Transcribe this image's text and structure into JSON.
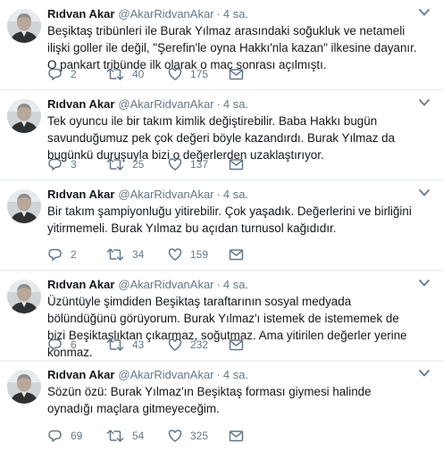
{
  "feed": {
    "tweets": [
      {
        "name": "Rıdvan Akar",
        "handle": "@AkarRidvanAkar",
        "dot": "·",
        "time": "4 sa.",
        "text": "Beşiktaş tribünleri ile Burak Yılmaz arasındaki soğukluk ve netameli ilişki goller ile değil, \"Şerefin'le oyna Hakkı'nla kazan\" ilkesine dayanır. O pankart tribünde ilk olarak o maç sonrası açılmıştı.",
        "replies": "2",
        "retweets": "40",
        "likes": "175"
      },
      {
        "name": "Rıdvan Akar",
        "handle": "@AkarRidvanAkar",
        "dot": "·",
        "time": "4 sa.",
        "text": "Tek oyuncu ile bir takım kimlik değiştirebilir. Baba Hakkı bugün savunduğumuz pek çok değeri böyle kazandırdı. Burak Yılmaz da bugünkü duruşuyla bizi o değerlerden uzaklaştırıyor.",
        "replies": "3",
        "retweets": "25",
        "likes": "137"
      },
      {
        "name": "Rıdvan Akar",
        "handle": "@AkarRidvanAkar",
        "dot": "·",
        "time": "4 sa.",
        "text": "Bir takım şampiyonluğu yitirebilir. Çok yaşadık. Değerlerini ve birliğini yitirmemeli. Burak Yılmaz bu açıdan turnusol kağıdıdır.",
        "replies": "2",
        "retweets": "34",
        "likes": "159"
      },
      {
        "name": "Rıdvan Akar",
        "handle": "@AkarRidvanAkar",
        "dot": "·",
        "time": "4 sa.",
        "text": "Üzüntüyle şimdiden Beşiktaş taraftarının sosyal medyada bölündüğünü görüyorum. Burak Yılmaz'ı istemek de istememek de bizi Beşiktaşlıktan çıkarmaz, soğutmaz. Ama yitirilen değerler yerine konmaz.",
        "replies": "6",
        "retweets": "43",
        "likes": "232"
      },
      {
        "name": "Rıdvan Akar",
        "handle": "@AkarRidvanAkar",
        "dot": "·",
        "time": "4 sa.",
        "text": "Sözün özü: Burak Yılmaz'ın Beşiktaş forması giymesi halinde oynadığı maçlara gitmeyeceğim.",
        "replies": "69",
        "retweets": "54",
        "likes": "325"
      }
    ]
  },
  "icons": {
    "avatar": "avatar-photo",
    "caret": "chevron-down-icon",
    "reply": "reply-icon",
    "retweet": "retweet-icon",
    "like": "heart-icon",
    "dm": "envelope-icon"
  },
  "colors": {
    "text": "#14171a",
    "secondary": "#657786",
    "icon": "#657786",
    "divider": "#e6ecf0",
    "background": "#ffffff"
  }
}
